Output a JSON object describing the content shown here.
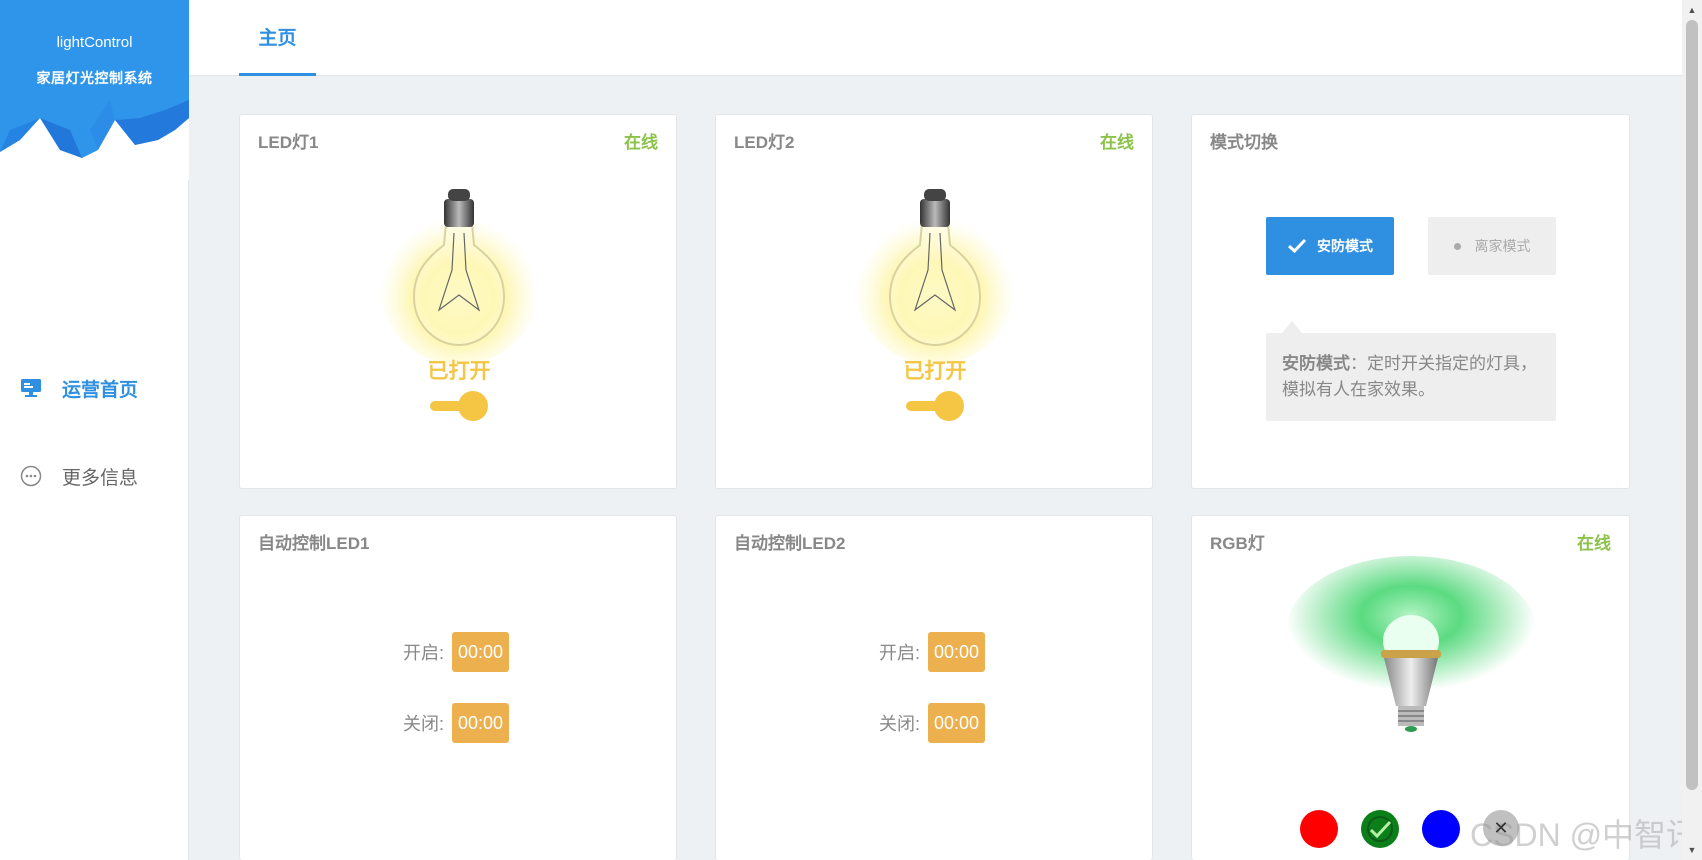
{
  "sidebar": {
    "app_name": "lightControl",
    "app_subtitle": "家居灯光控制系统",
    "nav": [
      {
        "label": "运营首页",
        "icon": "monitor-icon",
        "active": true
      },
      {
        "label": "更多信息",
        "icon": "more-circle-icon",
        "active": false
      }
    ]
  },
  "topbar": {
    "tabs": [
      {
        "label": "主页",
        "active": true
      }
    ]
  },
  "cards": {
    "led1": {
      "title": "LED灯1",
      "status": "在线",
      "state": "已打开",
      "on": true
    },
    "led2": {
      "title": "LED灯2",
      "status": "在线",
      "state": "已打开",
      "on": true
    },
    "mode": {
      "title": "模式切换",
      "buttons": [
        {
          "label": "安防模式",
          "selected": true,
          "icon": "check-icon"
        },
        {
          "label": "离家模式",
          "selected": false,
          "icon": "dot-icon"
        }
      ],
      "desc_bold": "安防模式",
      "desc_text": "：定时开关指定的灯具，模拟有人在家效果。"
    },
    "auto1": {
      "title": "自动控制LED1",
      "on_label": "开启:",
      "on_value": "00:00",
      "off_label": "关闭:",
      "off_value": "00:00"
    },
    "auto2": {
      "title": "自动控制LED2",
      "on_label": "开启:",
      "on_value": "00:00",
      "off_label": "关闭:",
      "off_value": "00:00"
    },
    "rgb": {
      "title": "RGB灯",
      "status": "在线",
      "glow_color": "#22c55e",
      "colors": [
        {
          "name": "red",
          "hex": "#ff0000",
          "selected": false
        },
        {
          "name": "green",
          "hex": "#0a7f1a",
          "selected": true
        },
        {
          "name": "blue",
          "hex": "#0000ff",
          "selected": false
        }
      ]
    }
  },
  "colors": {
    "accent": "#2f8fe0",
    "online": "#8bc34a",
    "bulb_on": "#f5c544",
    "time_badge": "#ecb04f"
  },
  "watermark": "CSDN @中智讯"
}
